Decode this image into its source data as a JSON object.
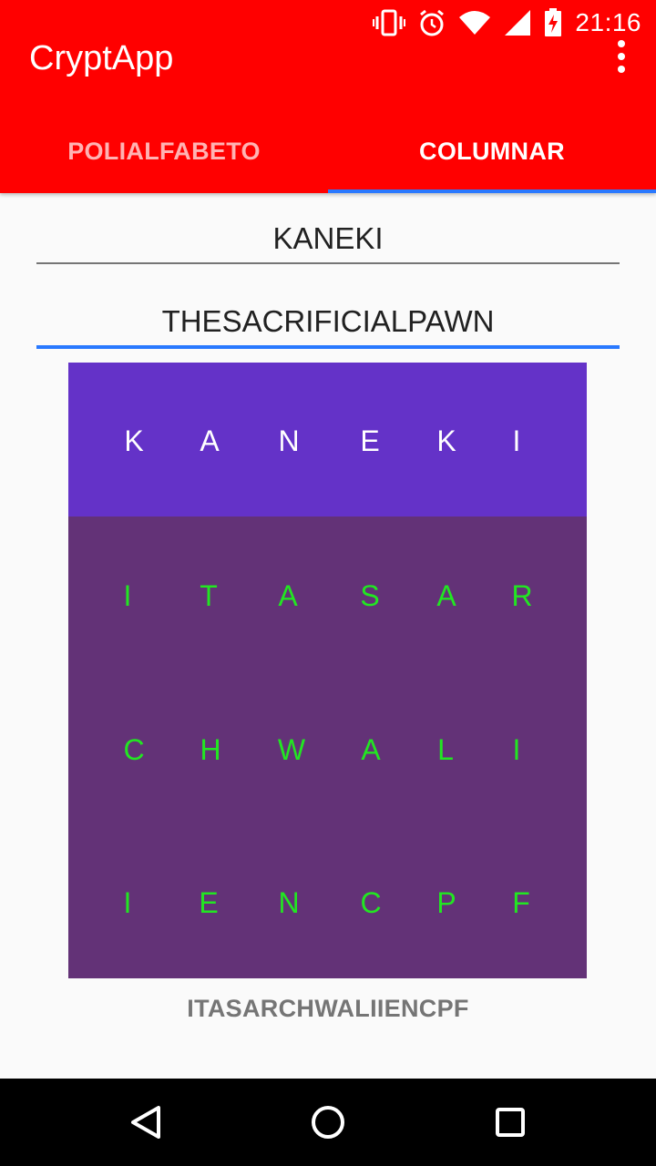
{
  "status_bar": {
    "time": "21:16",
    "icons": [
      "vibrate-icon",
      "alarm-icon",
      "wifi-icon",
      "signal-icon",
      "battery-charging-icon"
    ]
  },
  "app_bar": {
    "title": "CryptApp",
    "overflow_icon": "more-vert-icon"
  },
  "tabs": [
    {
      "label": "POLIALFABETO",
      "active": false
    },
    {
      "label": "COLUMNAR",
      "active": true
    }
  ],
  "key_field": {
    "value": "KANEKI"
  },
  "message_field": {
    "value": "THESACRIFICIALPAWN"
  },
  "grid": {
    "header": [
      "K",
      "A",
      "N",
      "E",
      "K",
      "I"
    ],
    "rows": [
      [
        "I",
        "T",
        "A",
        "S",
        "A",
        "R"
      ],
      [
        "C",
        "H",
        "W",
        "A",
        "L",
        "I"
      ],
      [
        "I",
        "E",
        "N",
        "C",
        "P",
        "F"
      ]
    ]
  },
  "result": "ITASARCHWALIIENCPF",
  "nav_bar": {
    "icons": [
      "back-icon",
      "home-icon",
      "recents-icon"
    ]
  },
  "colors": {
    "app_bar": "#ff0000",
    "tab_indicator": "#2979ff",
    "grid_header": "#6432c8",
    "grid_body": "#633277",
    "grid_body_text": "#22e622"
  }
}
